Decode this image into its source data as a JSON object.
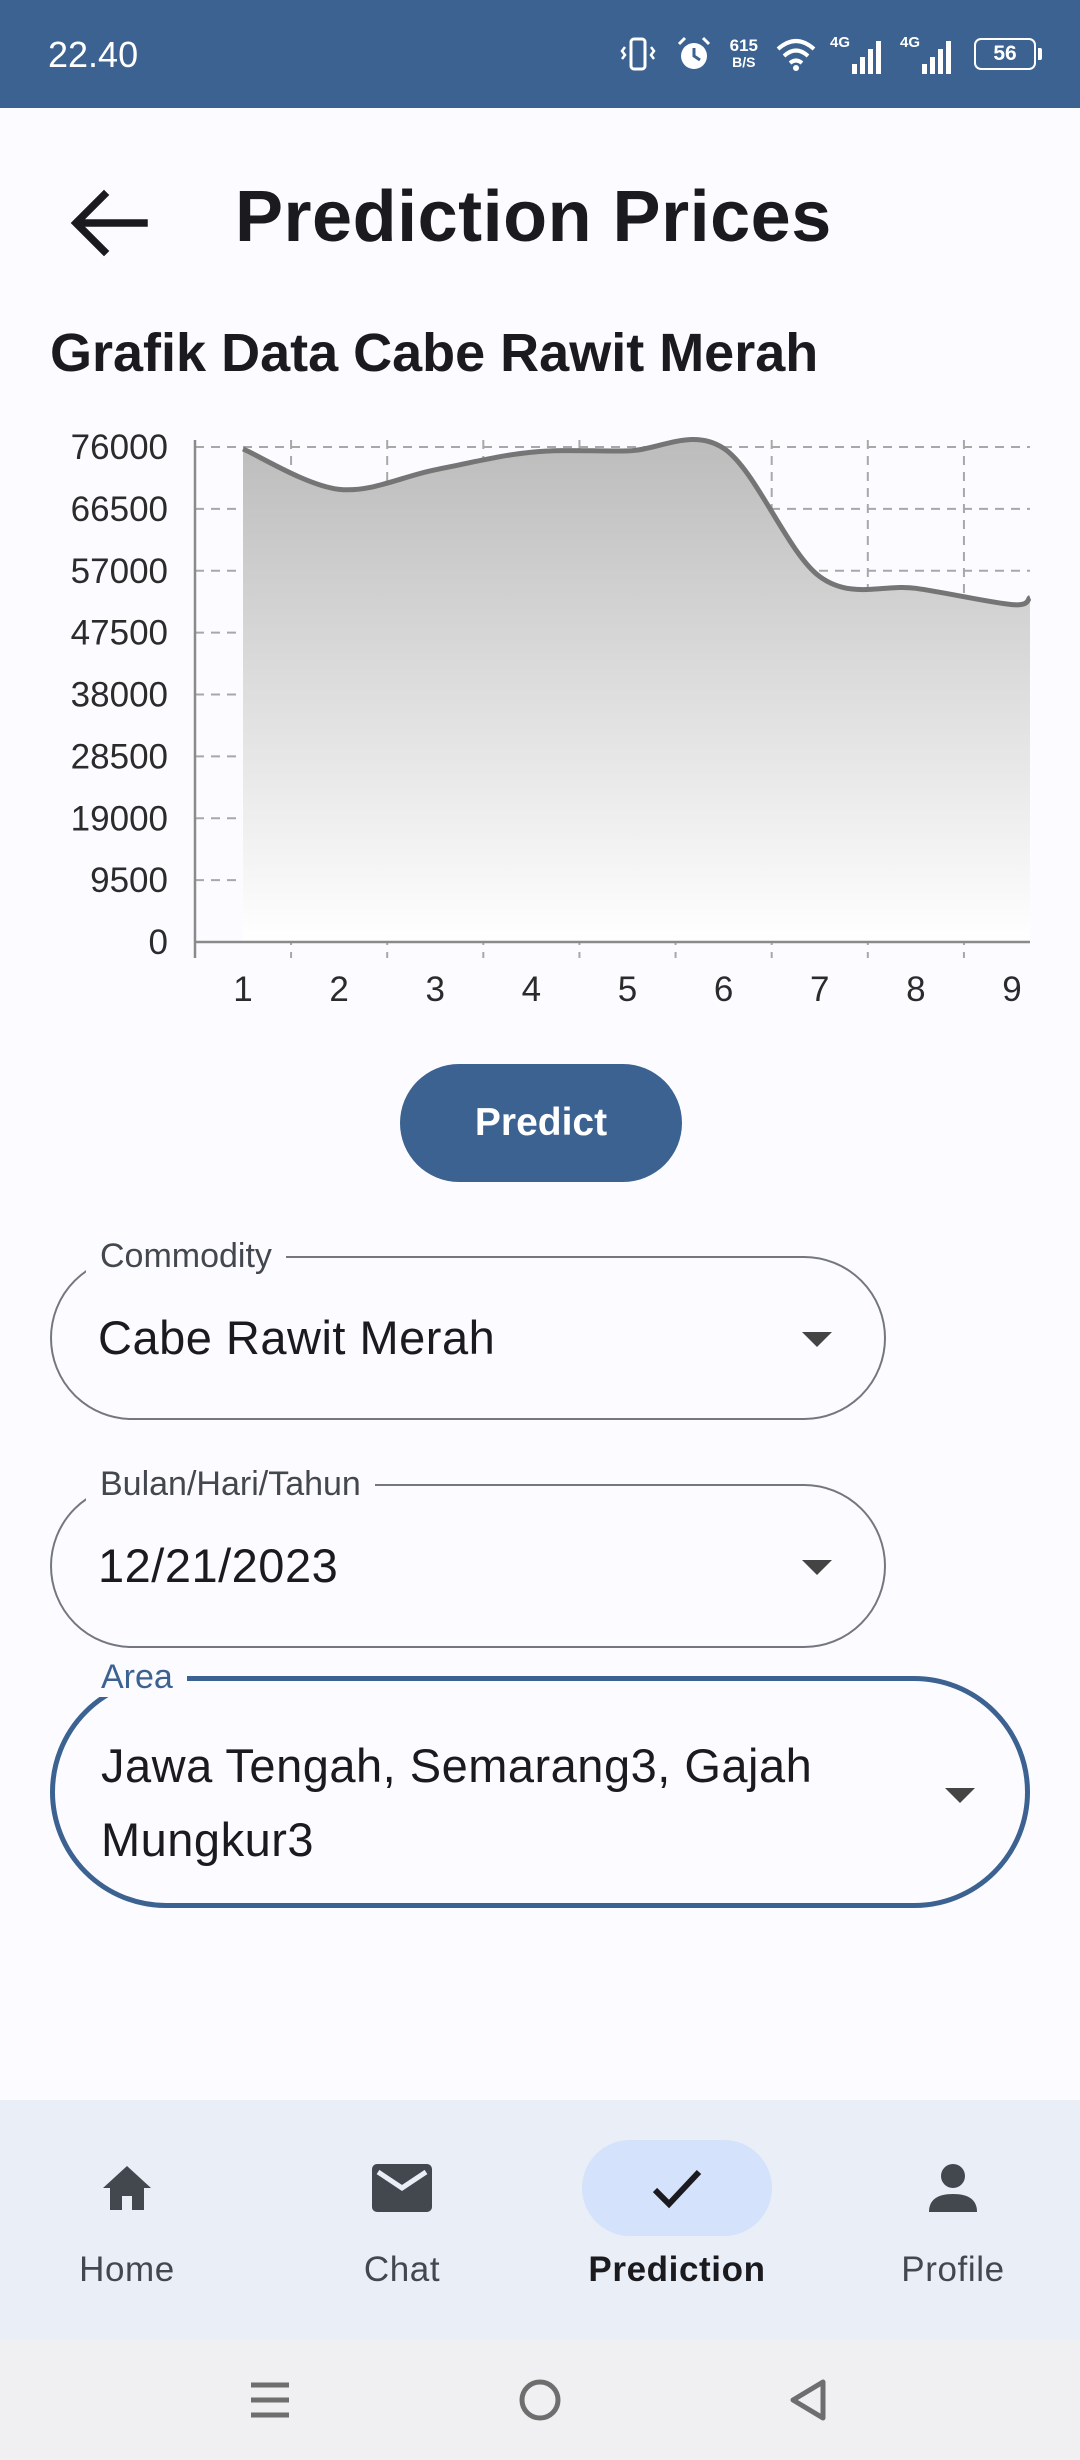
{
  "status_bar": {
    "time": "22.40",
    "network_speed_value": "615",
    "network_speed_unit": "B/S",
    "network_type_1": "4G",
    "network_type_2": "4G",
    "battery": "56",
    "icons": [
      "vibrate-icon",
      "alarm-icon",
      "wifi-icon",
      "signal-icon",
      "signal-icon",
      "battery-icon"
    ]
  },
  "header": {
    "title": "Prediction Prices",
    "back_icon": "arrow-left-icon"
  },
  "chart_section": {
    "title": "Grafik Data Cabe Rawit Merah"
  },
  "chart_data": {
    "type": "area",
    "title": "Grafik Data Cabe Rawit Merah",
    "x": [
      1,
      2,
      3,
      4,
      5,
      6,
      7,
      8,
      9
    ],
    "series": [
      {
        "values": [
          75700,
          69500,
          72500,
          75200,
          75400,
          75800,
          56100,
          54300,
          51800
        ]
      }
    ],
    "line_end": 52900,
    "ylim": [
      0,
      76000
    ],
    "yticks": [
      0,
      9500,
      19000,
      28500,
      38000,
      47500,
      57000,
      66500,
      76000
    ],
    "xticks": [
      1,
      2,
      3,
      4,
      5,
      6,
      7,
      8,
      9
    ],
    "grid": true,
    "line_color": "#757575",
    "fill_top_color": "#bcbcbc",
    "fill_bottom_color": "#ffffff"
  },
  "actions": {
    "predict_label": "Predict",
    "accent": "#3b6290"
  },
  "form": {
    "commodity": {
      "label": "Commodity",
      "value": "Cabe Rawit Merah"
    },
    "date": {
      "label": "Bulan/Hari/Tahun",
      "value": "12/21/2023"
    },
    "area": {
      "label": "Area",
      "value": "Jawa Tengah, Semarang3, Gajah Mungkur3"
    }
  },
  "bottom_nav": {
    "items": [
      {
        "label": "Home",
        "icon": "home-icon"
      },
      {
        "label": "Chat",
        "icon": "mail-icon"
      },
      {
        "label": "Prediction",
        "icon": "check-icon",
        "active": true
      },
      {
        "label": "Profile",
        "icon": "person-icon"
      }
    ]
  },
  "system_nav": {
    "icons": [
      "menu-icon",
      "home-circle-icon",
      "back-triangle-icon"
    ]
  }
}
